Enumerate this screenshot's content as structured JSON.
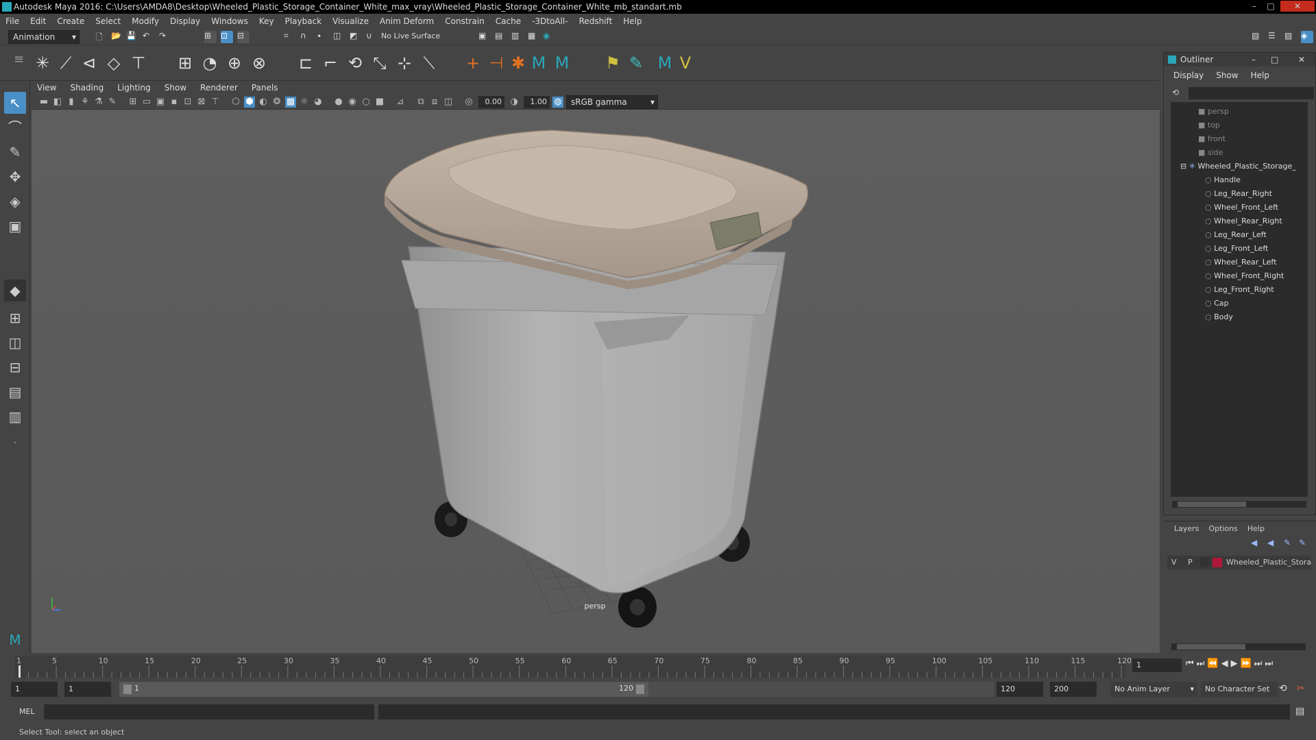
{
  "window": {
    "title": "Autodesk Maya 2016: C:\\Users\\AMDA8\\Desktop\\Wheeled_Plastic_Storage_Container_White_max_vray\\Wheeled_Plastic_Storage_Container_White_mb_standart.mb",
    "minimize": "–",
    "maximize": "□",
    "close": "✕"
  },
  "menubar": [
    "File",
    "Edit",
    "Create",
    "Select",
    "Modify",
    "Display",
    "Windows",
    "Key",
    "Playback",
    "Visualize",
    "Anim Deform",
    "Constrain",
    "Cache",
    "-3DtoAll-",
    "Redshift",
    "Help"
  ],
  "statusline": {
    "menuset": "Animation",
    "live_surface": "No Live Surface"
  },
  "viewport": {
    "menu": [
      "View",
      "Shading",
      "Lighting",
      "Show",
      "Renderer",
      "Panels"
    ],
    "exposure": "0.00",
    "gamma": "1.00",
    "color_space": "sRGB gamma",
    "camera_label": "persp"
  },
  "outliner": {
    "title": "Outliner",
    "menu": [
      "Display",
      "Show",
      "Help"
    ],
    "cameras": [
      "persp",
      "top",
      "front",
      "side"
    ],
    "group": "Wheeled_Plastic_Storage_",
    "children": [
      "Handle",
      "Leg_Rear_Right",
      "Wheel_Front_Left",
      "Wheel_Rear_Right",
      "Leg_Rear_Left",
      "Leg_Front_Left",
      "Wheel_Rear_Left",
      "Wheel_Front_Right",
      "Leg_Front_Right",
      "Cap",
      "Body"
    ]
  },
  "layers": {
    "menu": [
      "Layers",
      "Options",
      "Help"
    ],
    "row": {
      "v": "V",
      "p": "P",
      "name": "Wheeled_Plastic_Stora",
      "color": "#b0183a"
    }
  },
  "timeline": {
    "ticks": [
      "1",
      "5",
      "10",
      "15",
      "20",
      "25",
      "30",
      "35",
      "40",
      "45",
      "50",
      "55",
      "60",
      "65",
      "70",
      "75",
      "80",
      "85",
      "90",
      "95",
      "100",
      "105",
      "110",
      "115",
      "120"
    ],
    "current_frame": "1"
  },
  "range": {
    "start": "1",
    "playback_start": "1",
    "slider_start": "1",
    "slider_end": "120",
    "playback_end": "120",
    "end": "200",
    "anim_layer": "No Anim Layer",
    "char_set": "No Character Set"
  },
  "cmdline": {
    "label": "MEL"
  },
  "helpline": {
    "text": "Select Tool: select an object"
  },
  "colors": {
    "accent": "#4a90c8",
    "maya_teal": "#2aa7b8",
    "lid": "#b8a99a",
    "body": "#a8a8a8"
  }
}
